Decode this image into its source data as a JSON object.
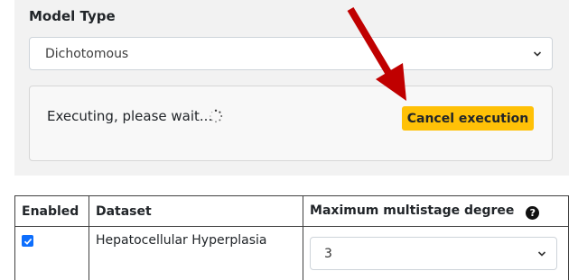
{
  "model": {
    "label": "Model Type",
    "selected": "Dichotomous"
  },
  "execution": {
    "status_text": "Executing, please wait...",
    "cancel_label": "Cancel execution"
  },
  "annotation": {
    "arrow_color": "#c00000"
  },
  "table": {
    "headers": [
      "Enabled",
      "Dataset",
      "Maximum multistage degree"
    ],
    "rows": [
      {
        "enabled": true,
        "dataset": "Hepatocellular Hyperplasia",
        "degree": "3"
      }
    ]
  },
  "colors": {
    "accent_button": "#ffc107",
    "checkbox": "#0d6efd"
  }
}
